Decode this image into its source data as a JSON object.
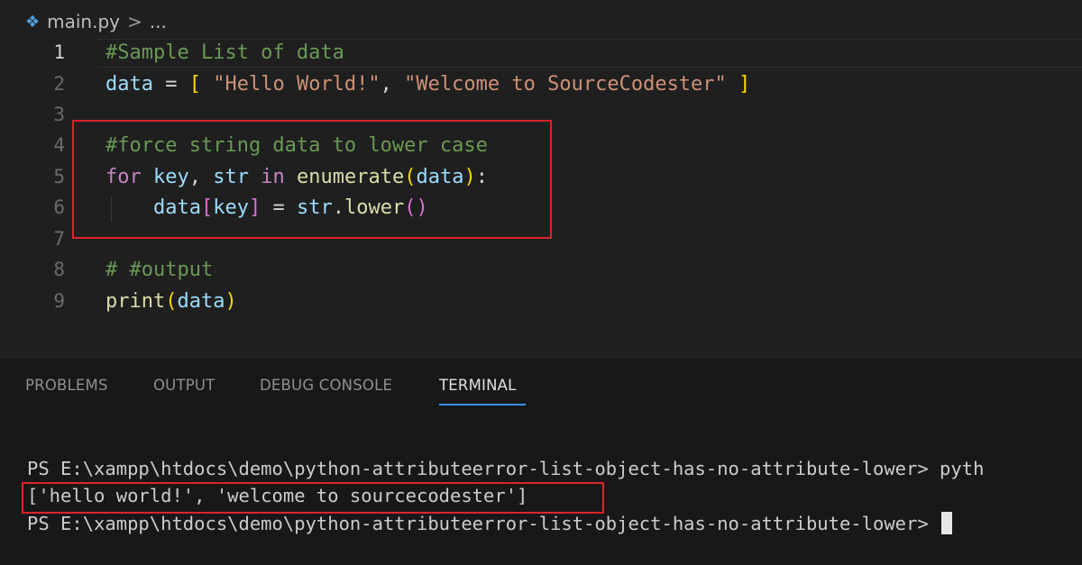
{
  "editor": {
    "breadcrumb": {
      "file": "main.py",
      "separator": ">",
      "more": "..."
    },
    "lines": [
      {
        "number": "1",
        "tokens": [
          {
            "t": "#Sample List of data",
            "c": "comment"
          }
        ]
      },
      {
        "number": "2",
        "tokens": [
          {
            "t": "data",
            "c": "var"
          },
          {
            "t": " = ",
            "c": "op"
          },
          {
            "t": "[",
            "c": "bracket"
          },
          {
            "t": " ",
            "c": "op"
          },
          {
            "t": "\"Hello World!\"",
            "c": "str"
          },
          {
            "t": ", ",
            "c": "op"
          },
          {
            "t": "\"Welcome to SourceCodester\"",
            "c": "str"
          },
          {
            "t": " ",
            "c": "op"
          },
          {
            "t": "]",
            "c": "bracket"
          }
        ]
      },
      {
        "number": "3",
        "tokens": []
      },
      {
        "number": "4",
        "tokens": [
          {
            "t": "#force string data to lower case",
            "c": "comment"
          }
        ]
      },
      {
        "number": "5",
        "tokens": [
          {
            "t": "for",
            "c": "kw"
          },
          {
            "t": " ",
            "c": "op"
          },
          {
            "t": "key",
            "c": "var"
          },
          {
            "t": ", ",
            "c": "op"
          },
          {
            "t": "str",
            "c": "var"
          },
          {
            "t": " ",
            "c": "op"
          },
          {
            "t": "in",
            "c": "kw"
          },
          {
            "t": " ",
            "c": "op"
          },
          {
            "t": "enumerate",
            "c": "fn"
          },
          {
            "t": "(",
            "c": "bracket"
          },
          {
            "t": "data",
            "c": "var"
          },
          {
            "t": ")",
            "c": "bracket"
          },
          {
            "t": ":",
            "c": "op"
          }
        ]
      },
      {
        "number": "6",
        "tokens": [
          {
            "t": "    ",
            "c": "op"
          },
          {
            "t": "data",
            "c": "var"
          },
          {
            "t": "[",
            "c": "paren2"
          },
          {
            "t": "key",
            "c": "var"
          },
          {
            "t": "]",
            "c": "paren2"
          },
          {
            "t": " = ",
            "c": "op"
          },
          {
            "t": "str",
            "c": "var"
          },
          {
            "t": ".",
            "c": "op"
          },
          {
            "t": "lower",
            "c": "fn"
          },
          {
            "t": "()",
            "c": "paren2"
          }
        ]
      },
      {
        "number": "7",
        "tokens": []
      },
      {
        "number": "8",
        "tokens": [
          {
            "t": "# #output",
            "c": "comment"
          }
        ]
      },
      {
        "number": "9",
        "tokens": [
          {
            "t": "print",
            "c": "fn"
          },
          {
            "t": "(",
            "c": "bracket"
          },
          {
            "t": "data",
            "c": "var"
          },
          {
            "t": ")",
            "c": "bracket"
          }
        ]
      }
    ],
    "active_line": "1"
  },
  "panel": {
    "tabs": [
      {
        "label": "PROBLEMS",
        "active": false
      },
      {
        "label": "OUTPUT",
        "active": false
      },
      {
        "label": "DEBUG CONSOLE",
        "active": false
      },
      {
        "label": "TERMINAL",
        "active": true
      }
    ],
    "terminal": {
      "line1": "PS E:\\xampp\\htdocs\\demo\\python-attributeerror-list-object-has-no-attribute-lower> pyth",
      "line2": "['hello world!', 'welcome to sourcecodester']",
      "line3": "PS E:\\xampp\\htdocs\\demo\\python-attributeerror-list-object-has-no-attribute-lower> "
    }
  },
  "colors": {
    "comment": "#6a9955",
    "variable": "#9cdcfe",
    "string": "#ce9178",
    "keyword": "#c586c0",
    "function": "#dcdcaa",
    "bracket": "#ffd700",
    "highlight_box": "#d9252a",
    "tab_underline": "#3794ff"
  }
}
